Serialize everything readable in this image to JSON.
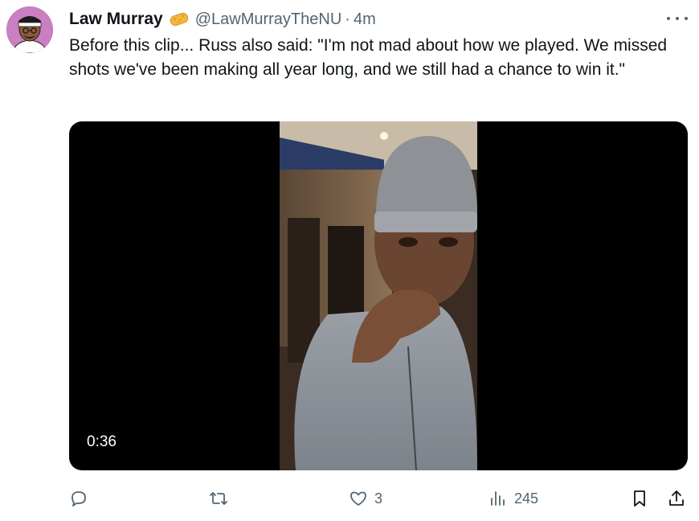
{
  "tweet": {
    "author": {
      "display_name": "Law Murray",
      "badge_icon": "sponge-emoji-icon",
      "handle": "@LawMurrayTheNU",
      "separator": "·",
      "time": "4m"
    },
    "text": "Before this clip... Russ also said: \"I'm not mad about how we played. We missed shots we've been making all year long, and we still had a chance to win it.\"",
    "media": {
      "type": "video",
      "duration": "0:36"
    },
    "actions": {
      "reply": {
        "icon": "reply-icon",
        "count": ""
      },
      "retweet": {
        "icon": "retweet-icon",
        "count": ""
      },
      "like": {
        "icon": "heart-icon",
        "count": "3"
      },
      "views": {
        "icon": "views-icon",
        "count": "245"
      },
      "bookmark": {
        "icon": "bookmark-icon"
      },
      "share": {
        "icon": "share-icon"
      }
    }
  },
  "colors": {
    "text": "#0f1419",
    "secondary": "#536471",
    "avatar_bg": "#c97fc0",
    "media_bg": "#000000"
  }
}
